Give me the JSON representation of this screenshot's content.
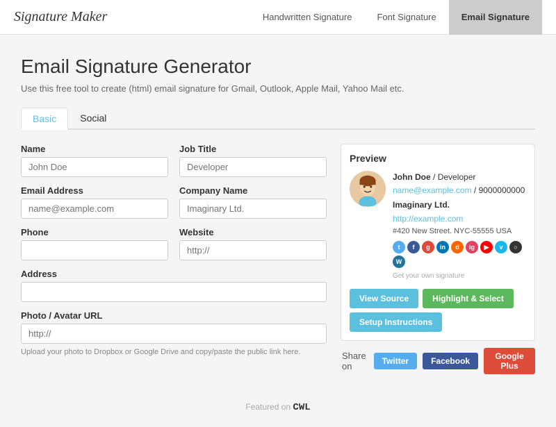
{
  "header": {
    "logo": "Signature Maker",
    "nav": [
      {
        "id": "handwritten",
        "label": "Handwritten Signature",
        "active": false
      },
      {
        "id": "font",
        "label": "Font Signature",
        "active": false
      },
      {
        "id": "email",
        "label": "Email Signature",
        "active": true
      }
    ]
  },
  "page": {
    "title": "Email Signature Generator",
    "subtitle": "Use this free tool to create (html) email signature for Gmail, Outlook, Apple Mail, Yahoo Mail etc."
  },
  "tabs": [
    {
      "id": "basic",
      "label": "Basic",
      "active": true
    },
    {
      "id": "social",
      "label": "Social",
      "active": false
    }
  ],
  "form": {
    "name_label": "Name",
    "name_placeholder": "John Doe",
    "jobtitle_label": "Job Title",
    "jobtitle_placeholder": "Developer",
    "email_label": "Email Address",
    "email_placeholder": "name@example.com",
    "company_label": "Company Name",
    "company_placeholder": "Imaginary Ltd.",
    "phone_label": "Phone",
    "phone_placeholder": "",
    "website_label": "Website",
    "website_placeholder": "http://",
    "address_label": "Address",
    "address_placeholder": "",
    "photo_label": "Photo / Avatar URL",
    "photo_placeholder": "http://",
    "photo_hint": "Upload your photo to Dropbox or Google Drive and copy/paste the public link here."
  },
  "preview": {
    "title": "Preview",
    "name": "John Doe",
    "jobtitle": "Developer",
    "email": "name@example.com",
    "phone": "9000000000",
    "company": "Imaginary Ltd.",
    "website": "http://example.com",
    "address": "#420 New Street. NYC-55555 USA",
    "watermark": "Get your own signature",
    "social_icons": [
      {
        "color": "#55acee",
        "label": "t"
      },
      {
        "color": "#3b5998",
        "label": "f"
      },
      {
        "color": "#dd4b39",
        "label": "g"
      },
      {
        "color": "#0077b5",
        "label": "in"
      },
      {
        "color": "#ff6600",
        "label": "d"
      },
      {
        "color": "#e4405f",
        "label": "ig"
      },
      {
        "color": "#ff0000",
        "label": "yt"
      },
      {
        "color": "#1ab7ea",
        "label": "v"
      },
      {
        "color": "#333",
        "label": "gh"
      },
      {
        "color": "#21759b",
        "label": "wp"
      }
    ],
    "buttons": [
      {
        "id": "view-source",
        "label": "View Source",
        "style": "teal"
      },
      {
        "id": "highlight-select",
        "label": "Highlight & Select",
        "style": "green"
      },
      {
        "id": "setup-instructions",
        "label": "Setup Instructions",
        "style": "teal2"
      }
    ]
  },
  "share": {
    "label": "Share on",
    "buttons": [
      {
        "id": "twitter",
        "label": "Twitter",
        "style": "twitter"
      },
      {
        "id": "facebook",
        "label": "Facebook",
        "style": "facebook"
      },
      {
        "id": "google-plus",
        "label": "Google Plus",
        "style": "google"
      }
    ]
  },
  "footer": {
    "text": "Featured on",
    "brand": "CWL"
  }
}
